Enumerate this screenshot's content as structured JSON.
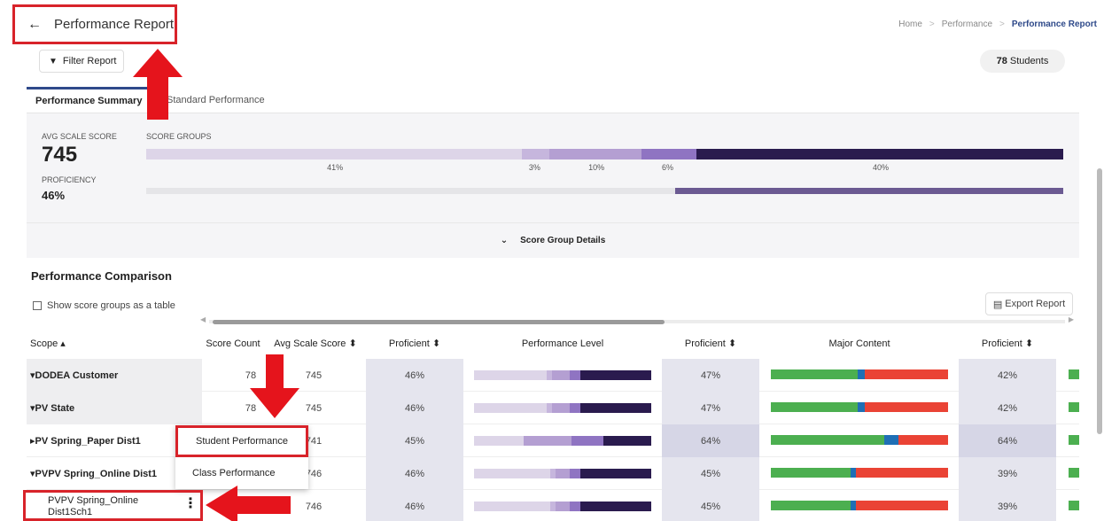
{
  "header": {
    "title": "Performance Report",
    "breadcrumb": [
      "Home",
      "Performance",
      "Performance Report"
    ]
  },
  "toolbar": {
    "filter_label": "Filter Report",
    "students_count": "78",
    "students_label": "Students"
  },
  "tabs": [
    {
      "label": "Performance Summary",
      "active": true
    },
    {
      "label": "Standard Performance",
      "active": false
    }
  ],
  "summary": {
    "avg_scale_score_label": "AVG SCALE SCORE",
    "avg_scale_score": "745",
    "score_groups_label": "SCORE GROUPS",
    "proficiency_label": "PROFICIENCY",
    "proficiency": "46%",
    "score_groups": [
      {
        "pct": "41%",
        "color": "#ddd5e8",
        "value": 41
      },
      {
        "pct": "3%",
        "color": "#c6b6dd",
        "value": 3
      },
      {
        "pct": "10%",
        "color": "#b49fd2",
        "value": 10
      },
      {
        "pct": "6%",
        "color": "#8f74c2",
        "value": 6
      },
      {
        "pct": "40%",
        "color": "#2a1b4e",
        "value": 40
      }
    ],
    "proficiency_value": 46
  },
  "score_group_details_label": "Score Group Details",
  "comparison": {
    "title": "Performance Comparison",
    "show_table_label": "Show score groups as a table",
    "export_label": "Export Report",
    "columns": [
      "Scope ▴",
      "Score Count",
      "Avg Scale Score ⬍",
      "Proficient ⬍",
      "Performance Level",
      "Proficient ⬍",
      "Major Content",
      "Proficient ⬍"
    ],
    "rows": [
      {
        "scope": "▾DODEA Customer",
        "count": "78",
        "avg": "745",
        "prof1": "46%",
        "prof2": "47%",
        "prof3": "42%"
      },
      {
        "scope": "▾PV State",
        "count": "78",
        "avg": "745",
        "prof1": "46%",
        "prof2": "47%",
        "prof3": "42%"
      },
      {
        "scope": "▸PV Spring_Paper Dist1",
        "count": "",
        "avg": "741",
        "prof1": "45%",
        "prof2": "64%",
        "prof3": "64%"
      },
      {
        "scope": "▾PVPV Spring_Online Dist1",
        "count": "",
        "avg": "746",
        "prof1": "46%",
        "prof2": "45%",
        "prof3": "39%"
      },
      {
        "scope": "PVPV Spring_Online Dist1Sch1",
        "count": "",
        "avg": "746",
        "prof1": "46%",
        "prof2": "45%",
        "prof3": "39%"
      }
    ]
  },
  "context_menu": {
    "items": [
      "Student Performance",
      "Class Performance"
    ]
  },
  "colors": {
    "accent": "#2f4a8a",
    "annotation_red": "#d8232a",
    "green": "#4caf50",
    "blue": "#1f6fb5",
    "red": "#ea4335"
  }
}
